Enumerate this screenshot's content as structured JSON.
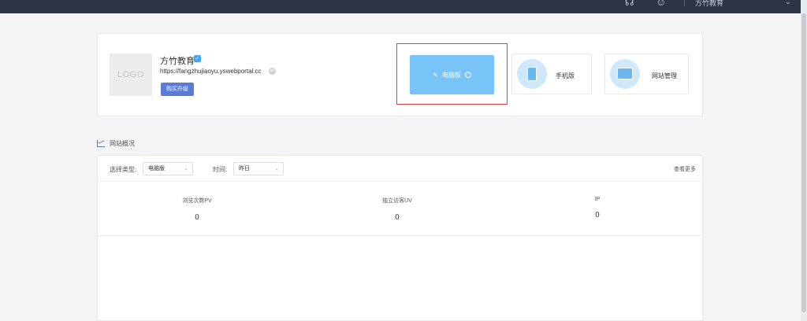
{
  "topbar": {
    "headset_icon": "headset-icon",
    "user_icon": "user-icon",
    "username": "方竹教育",
    "caret": "⌄"
  },
  "site": {
    "logo_text": "LOGO",
    "name": "方竹教育",
    "url": "https://fangzhujiaoyu.yswebportal.cc",
    "upgrade_label": "购买升级"
  },
  "versions": {
    "pc_label": "电脑版",
    "mobile_label": "手机版",
    "admin_label": "网站管理"
  },
  "overview": {
    "title": "网站概况",
    "type_label": "选择类型:",
    "type_value": "电脑版",
    "time_label": "时间:",
    "time_value": "昨日",
    "view_more": "查看更多",
    "stats": [
      {
        "label": "浏览次数PV",
        "value": "0"
      },
      {
        "label": "独立访客UV",
        "value": "0"
      },
      {
        "label": "IP",
        "value": "0"
      }
    ]
  },
  "colors": {
    "topbar": "#2d3446",
    "accent": "#78c3f7",
    "button": "#5b7bd5",
    "highlight": "#e23c3c"
  }
}
